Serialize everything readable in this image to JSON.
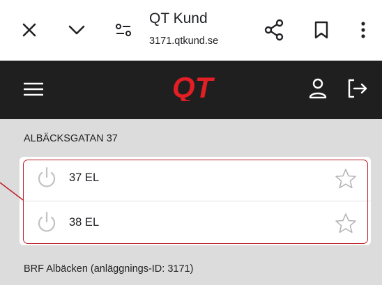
{
  "browser": {
    "title": "QT Kund",
    "url": "3171.qtkund.se"
  },
  "app": {
    "logo_text": "QT",
    "brand_color": "#e31e24",
    "header_bg": "#1f1f1f"
  },
  "section": {
    "title": "ALBÄCKSGATAN 37",
    "items": [
      {
        "label": "37 EL",
        "icon": "power-icon",
        "favorite_icon": "star-outline-icon"
      },
      {
        "label": "38 EL",
        "icon": "power-icon",
        "favorite_icon": "star-outline-icon"
      }
    ]
  },
  "footer": {
    "text": "BRF Albäcken (anläggnings-ID: 3171)"
  },
  "annotation_color": "#c0202a"
}
